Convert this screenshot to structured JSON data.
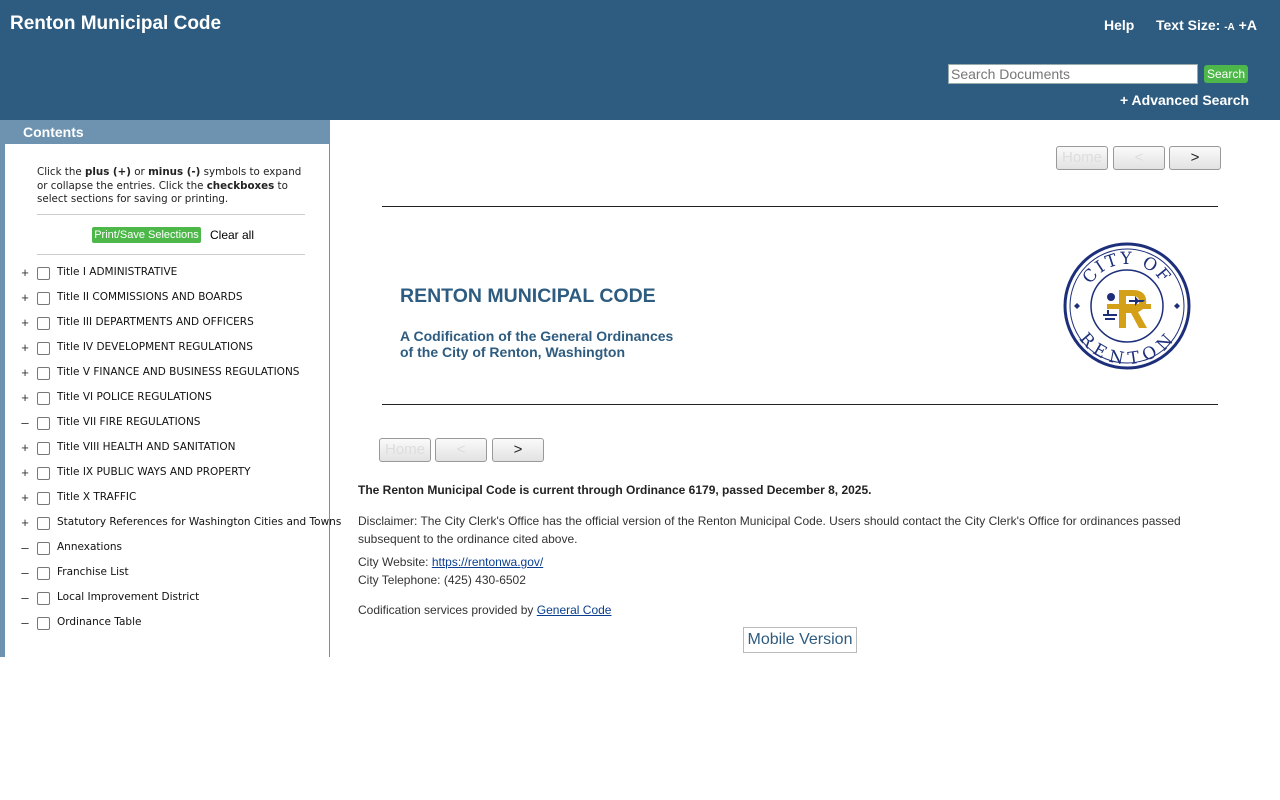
{
  "header": {
    "title": "Renton Municipal Code",
    "help": "Help",
    "text_size_label": "Text Size:",
    "text_size_small": "-A",
    "text_size_large": "+A",
    "search_placeholder": "Search Documents",
    "search_button": "Search",
    "advanced_search": "+ Advanced Search"
  },
  "sidebar": {
    "heading": "Contents",
    "instructions": {
      "p1": "Click the ",
      "plus": "plus (+)",
      "p2": " or ",
      "minus": "minus (-)",
      "p3": " symbols to expand or collapse the entries. Click the ",
      "checkboxes": "checkboxes",
      "p4": " to select sections for saving or printing."
    },
    "print_save": "Print/Save Selections",
    "clear_all": "Clear all",
    "items": [
      {
        "toggle": "+",
        "label": "Title I ADMINISTRATIVE"
      },
      {
        "toggle": "+",
        "label": "Title II COMMISSIONS AND BOARDS"
      },
      {
        "toggle": "+",
        "label": "Title III DEPARTMENTS AND OFFICERS"
      },
      {
        "toggle": "+",
        "label": "Title IV DEVELOPMENT REGULATIONS"
      },
      {
        "toggle": "+",
        "label": "Title V FINANCE AND BUSINESS REGULATIONS"
      },
      {
        "toggle": "+",
        "label": "Title VI POLICE REGULATIONS"
      },
      {
        "toggle": "–",
        "label": "Title VII FIRE REGULATIONS"
      },
      {
        "toggle": "+",
        "label": "Title VIII HEALTH AND SANITATION"
      },
      {
        "toggle": "+",
        "label": "Title IX PUBLIC WAYS AND PROPERTY"
      },
      {
        "toggle": "+",
        "label": "Title X TRAFFIC"
      },
      {
        "toggle": "+",
        "label": "Statutory References for Washington Cities and Towns"
      },
      {
        "toggle": "–",
        "label": "Annexations"
      },
      {
        "toggle": "–",
        "label": "Franchise List"
      },
      {
        "toggle": "–",
        "label": "Local Improvement District"
      },
      {
        "toggle": "–",
        "label": "Ordinance Table"
      }
    ]
  },
  "nav": {
    "home": "Home",
    "prev": "<",
    "next": ">"
  },
  "main": {
    "code_title": "RENTON MUNICIPAL CODE",
    "subtitle_line1": "A Codification of the General Ordinances",
    "subtitle_line2": "of the City of Renton, Washington",
    "seal_top_text": "CITY OF",
    "seal_bottom_text": "RENTON",
    "current_through": "The Renton Municipal Code is current through Ordinance 6179, passed December 8, 2025.",
    "disclaimer": "Disclaimer: The City Clerk's Office has the official version of the Renton Municipal Code. Users should contact the City Clerk's Office for ordinances passed subsequent to the ordinance cited above.",
    "website_label": "City Website: ",
    "website_url": "https://rentonwa.gov/",
    "phone": "City Telephone: (425) 430-6502",
    "codification_label": "Codification services provided by ",
    "codification_link": "General Code",
    "mobile_version": "Mobile Version"
  },
  "colors": {
    "header_bg": "#2e5c80",
    "sidebar_accent": "#6e93b0",
    "button_green": "#4db849",
    "seal_navy": "#1d2f7a",
    "seal_gold": "#d4a017"
  }
}
